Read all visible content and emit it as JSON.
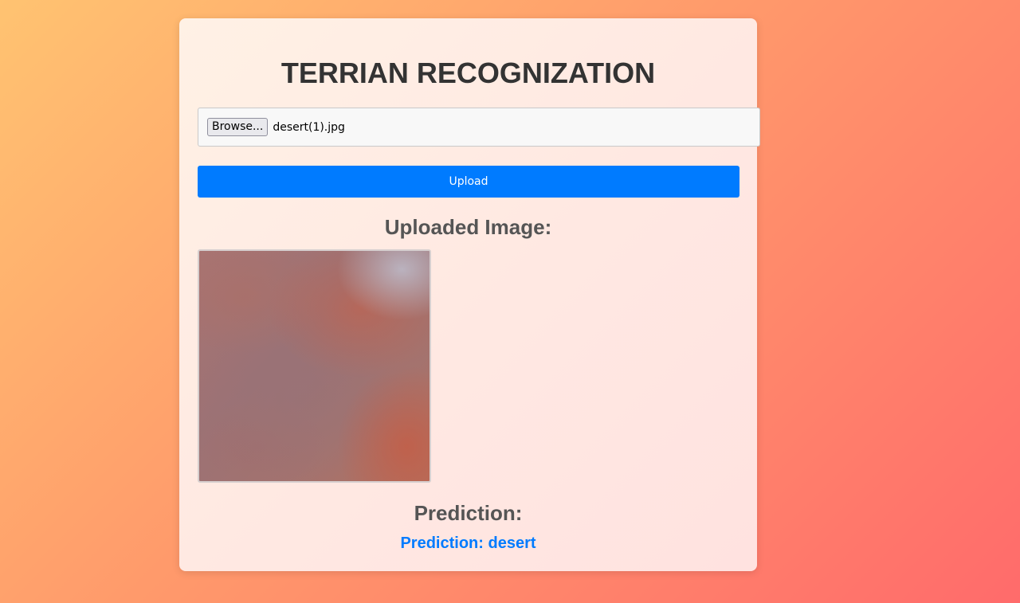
{
  "page": {
    "title": "TERRIAN RECOGNIZATION"
  },
  "file_input": {
    "browse_label": "Browse...",
    "file_name": "desert(1).jpg"
  },
  "upload_button": {
    "label": "Upload"
  },
  "uploaded_section": {
    "heading": "Uploaded Image:",
    "image_alt": "desert satellite image"
  },
  "prediction_section": {
    "heading": "Prediction:",
    "result": "Prediction: desert"
  },
  "colors": {
    "accent": "#007bff",
    "title": "#333333",
    "heading": "#555555"
  }
}
